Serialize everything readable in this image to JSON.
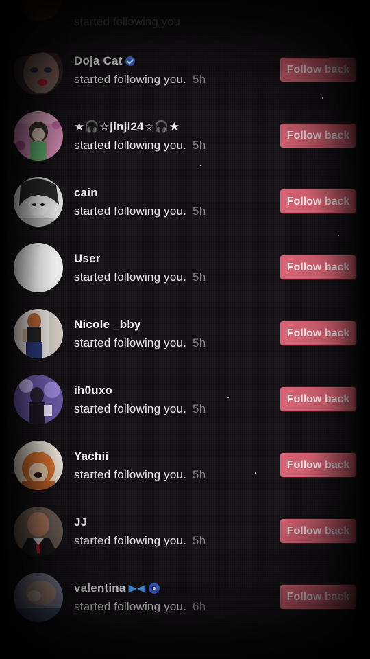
{
  "top_partial": {
    "text": "started following you"
  },
  "notifications": [
    {
      "name": "Doja Cat",
      "verified": true,
      "action": "started following you.",
      "time": "5h",
      "button": "Follow back"
    },
    {
      "name": "★🎧☆jinji24☆🎧★",
      "verified": false,
      "action": "started following you.",
      "time": "5h",
      "button": "Follow back"
    },
    {
      "name": "cain",
      "verified": false,
      "action": "started following you.",
      "time": "5h",
      "button": "Follow back"
    },
    {
      "name": "User",
      "verified": false,
      "action": "started following you.",
      "time": "5h",
      "button": "Follow back"
    },
    {
      "name": "Nicole _bby",
      "verified": false,
      "action": "started following you.",
      "time": "5h",
      "button": "Follow back"
    },
    {
      "name": "ih0uxo",
      "verified": false,
      "action": "started following you.",
      "time": "5h",
      "button": "Follow back"
    },
    {
      "name": "Yachii",
      "verified": false,
      "action": "started following you.",
      "time": "5h",
      "button": "Follow back"
    },
    {
      "name": "JJ",
      "verified": false,
      "action": "started following you.",
      "time": "5h",
      "button": "Follow back"
    },
    {
      "name": "valentina",
      "verified": false,
      "action": "started following you.",
      "time": "6h",
      "button": "Follow back"
    }
  ],
  "colors": {
    "background": "#141114",
    "button": "#d76373",
    "button_text": "#fbecee",
    "name_text": "#f2f2f2",
    "time_text": "#7f7f86",
    "verified_badge": "#3e6fe0"
  },
  "icons": {
    "verified": "verified-badge-icon",
    "butterfly": "butterfly-emoji-icon",
    "eye": "evil-eye-emoji-icon"
  }
}
